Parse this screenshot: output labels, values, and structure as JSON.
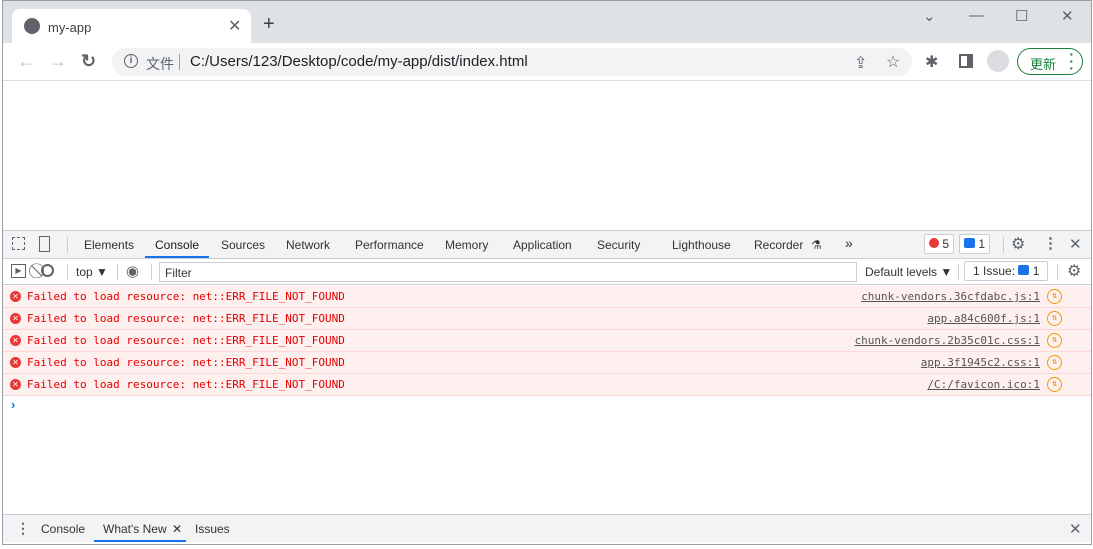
{
  "browser": {
    "tab_title": "my-app",
    "omnibox": {
      "security_label": "文件",
      "url": "C:/Users/123/Desktop/code/my-app/dist/index.html"
    },
    "update_label": "更新"
  },
  "devtools": {
    "tabs": [
      "Elements",
      "Console",
      "Sources",
      "Network",
      "Performance",
      "Memory",
      "Application",
      "Security",
      "Lighthouse",
      "Recorder"
    ],
    "active_tab": "Console",
    "more_tabs": "»",
    "error_count": "5",
    "message_count": "1",
    "context": "top",
    "filter_placeholder": "Filter",
    "levels": "Default levels",
    "issues_label": "1 Issue:",
    "issues_count": "1",
    "messages": [
      {
        "text": "Failed to load resource: net::ERR_FILE_NOT_FOUND",
        "source": "chunk-vendors.36cfdabc.js:1"
      },
      {
        "text": "Failed to load resource: net::ERR_FILE_NOT_FOUND",
        "source": "app.a84c600f.js:1"
      },
      {
        "text": "Failed to load resource: net::ERR_FILE_NOT_FOUND",
        "source": "chunk-vendors.2b35c01c.css:1"
      },
      {
        "text": "Failed to load resource: net::ERR_FILE_NOT_FOUND",
        "source": "app.3f1945c2.css:1"
      },
      {
        "text": "Failed to load resource: net::ERR_FILE_NOT_FOUND",
        "source": "/C:/favicon.ico:1"
      }
    ],
    "prompt": "›",
    "drawer_tabs": [
      "Console",
      "What's New",
      "Issues"
    ],
    "drawer_active": "What's New"
  },
  "colors": {
    "accent": "#1a73e8",
    "error": "#e50000",
    "error_bg": "#fff0f0",
    "update": "#188038"
  }
}
